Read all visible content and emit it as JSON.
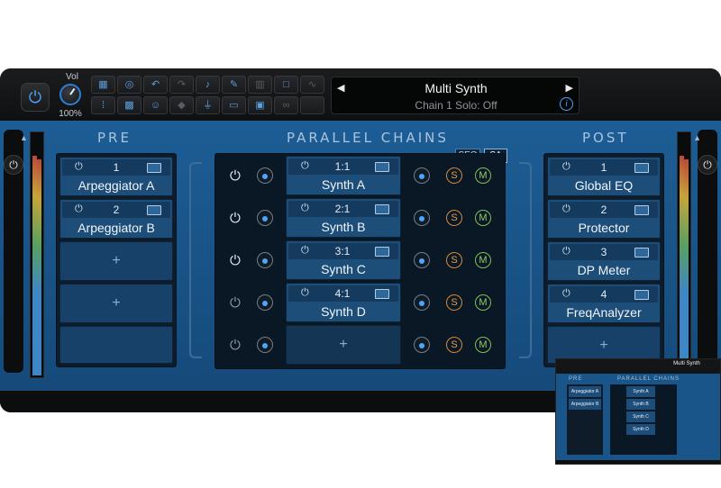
{
  "header": {
    "vol_label": "Vol",
    "vol_value": "100%",
    "preset_name": "Multi Synth",
    "preset_status": "Chain 1 Solo: Off",
    "prev_glyph": "◀",
    "next_glyph": "▶",
    "info_glyph": "i"
  },
  "toolbar": {
    "tools": [
      "grid-icon",
      "cycle-icon",
      "undo-icon",
      "redo-icon",
      "midi-icon",
      "pen-icon",
      "bars-icon",
      "square-icon",
      "curve-icon",
      "dots-icon",
      "pattern-icon",
      "person-icon",
      "diamond-icon",
      "plug-icon",
      "window-icon",
      "window2-icon",
      "link-icon",
      "blank-icon"
    ]
  },
  "sections": {
    "pre_title": "PRE",
    "parallel_title": "PARALLEL CHAINS",
    "post_title": "POST",
    "seq_label": "SEQ",
    "sa_label": "SA"
  },
  "pre": {
    "slots": [
      {
        "num": "1",
        "name": "Arpeggiator A"
      },
      {
        "num": "2",
        "name": "Arpeggiator B"
      }
    ],
    "empty_label": "+"
  },
  "post": {
    "slots": [
      {
        "num": "1",
        "name": "Global EQ"
      },
      {
        "num": "2",
        "name": "Protector"
      },
      {
        "num": "3",
        "name": "DP Meter"
      },
      {
        "num": "4",
        "name": "FreqAnalyzer"
      }
    ],
    "empty_label": "+"
  },
  "parallel": {
    "chains": [
      {
        "num": "1:1",
        "name": "Synth A"
      },
      {
        "num": "2:1",
        "name": "Synth B"
      },
      {
        "num": "3:1",
        "name": "Synth C"
      },
      {
        "num": "4:1",
        "name": "Synth D"
      }
    ],
    "empty_label": "+",
    "solo_label": "S",
    "mute_label": "M"
  },
  "thumbnail": {
    "preset_name": "Multi Synth",
    "pre_title": "PRE",
    "parallel_title": "PARALLEL CHAINS",
    "pre_slots": [
      "Arpeggiator A",
      "Arpeggiator B"
    ],
    "chain_slots": [
      "Synth A",
      "Synth B",
      "Synth C",
      "Synth D"
    ]
  },
  "colors": {
    "accent": "#4aa6ff",
    "panel_blue": "#1d5d95",
    "solo": "#e39b4b",
    "mute": "#8fcf69"
  }
}
